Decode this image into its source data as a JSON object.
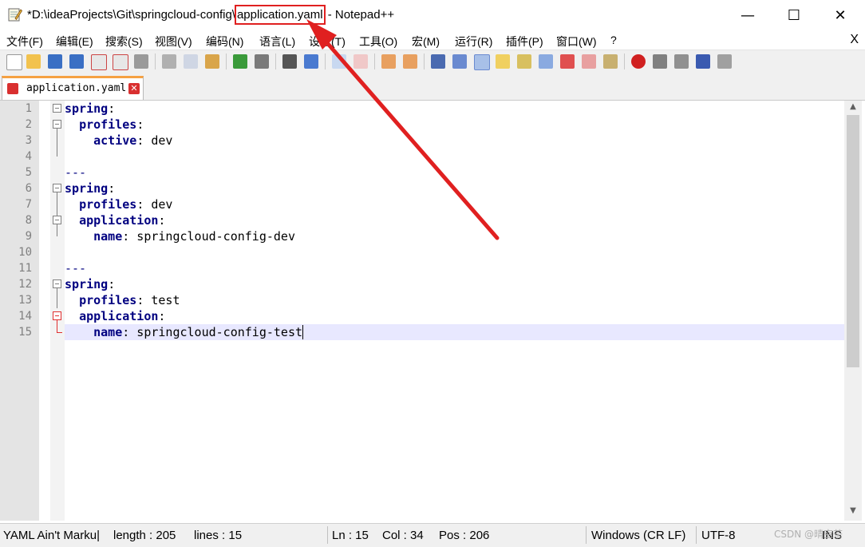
{
  "window": {
    "title_prefix": "*D:\\ideaProjects\\Git\\springcloud-config\\",
    "title_file": "application.yaml",
    "title_suffix": " - Notepad++",
    "min_glyph": "—",
    "max_glyph": "☐",
    "close_glyph": "✕"
  },
  "menu": {
    "items": [
      "文件(F)",
      "编辑(E)",
      "搜索(S)",
      "视图(V)",
      "编码(N)",
      "语言(L)",
      "设置(T)",
      "工具(O)",
      "宏(M)",
      "运行(R)",
      "插件(P)",
      "窗口(W)",
      "?"
    ],
    "close_glyph": "X"
  },
  "tab": {
    "label": "application.yaml",
    "close_glyph": "✕"
  },
  "editor": {
    "lines": [
      {
        "num": "1",
        "key": "spring",
        "indent": "",
        "value": ""
      },
      {
        "num": "2",
        "key": "profiles",
        "indent": "  ",
        "value": ""
      },
      {
        "num": "3",
        "key": "active",
        "indent": "    ",
        "value": " dev"
      },
      {
        "num": "4",
        "key": "",
        "indent": "",
        "value": ""
      },
      {
        "num": "5",
        "key": "",
        "indent": "",
        "value": "---"
      },
      {
        "num": "6",
        "key": "spring",
        "indent": "",
        "value": ""
      },
      {
        "num": "7",
        "key": "profiles",
        "indent": "  ",
        "value": " dev"
      },
      {
        "num": "8",
        "key": "application",
        "indent": "  ",
        "value": ""
      },
      {
        "num": "9",
        "key": "name",
        "indent": "    ",
        "value": " springcloud-config-dev"
      },
      {
        "num": "10",
        "key": "",
        "indent": "",
        "value": ""
      },
      {
        "num": "11",
        "key": "",
        "indent": "",
        "value": "---"
      },
      {
        "num": "12",
        "key": "spring",
        "indent": "",
        "value": ""
      },
      {
        "num": "13",
        "key": "profiles",
        "indent": "  ",
        "value": " test"
      },
      {
        "num": "14",
        "key": "application",
        "indent": "  ",
        "value": ""
      },
      {
        "num": "15",
        "key": "name",
        "indent": "    ",
        "value": " springcloud-config-test"
      }
    ]
  },
  "status": {
    "language": "YAML Ain't Marku|",
    "length": "length : 205",
    "lines": "lines : 15",
    "ln": "Ln : 15",
    "col": "Col : 34",
    "pos": "Pos : 206",
    "eol": "Windows (CR LF)",
    "encoding": "UTF-8",
    "mode": "INS"
  },
  "watermark": "CSDN @晴空茶",
  "colors": {
    "highlight_box": "#e02020",
    "arrow": "#e02020",
    "key": "#000080",
    "current_line": "#e8e8ff",
    "tab_accent": "#f5a142"
  }
}
